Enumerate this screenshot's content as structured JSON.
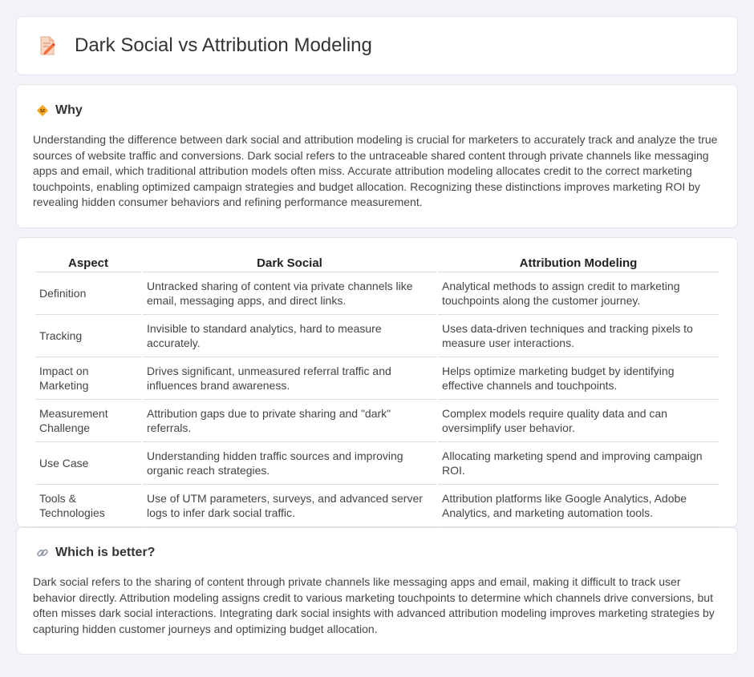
{
  "header": {
    "title": "Dark Social vs Attribution Modeling",
    "icon": "document-edit-icon"
  },
  "why": {
    "title": "Why",
    "icon": "warning-sign-icon",
    "text": "Understanding the difference between dark social and attribution modeling is crucial for marketers to accurately track and analyze the true sources of website traffic and conversions. Dark social refers to the untraceable shared content through private channels like messaging apps and email, which traditional attribution models often miss. Accurate attribution modeling allocates credit to the correct marketing touchpoints, enabling optimized campaign strategies and budget allocation. Recognizing these distinctions improves marketing ROI by revealing hidden consumer behaviors and refining performance measurement."
  },
  "comparison": {
    "headers": [
      "Aspect",
      "Dark Social",
      "Attribution Modeling"
    ],
    "rows": [
      [
        "Definition",
        "Untracked sharing of content via private channels like email, messaging apps, and direct links.",
        "Analytical methods to assign credit to marketing touchpoints along the customer journey."
      ],
      [
        "Tracking",
        "Invisible to standard analytics, hard to measure accurately.",
        "Uses data-driven techniques and tracking pixels to measure user interactions."
      ],
      [
        "Impact on Marketing",
        "Drives significant, unmeasured referral traffic and influences brand awareness.",
        "Helps optimize marketing budget by identifying effective channels and touchpoints."
      ],
      [
        "Measurement Challenge",
        "Attribution gaps due to private sharing and \"dark\" referrals.",
        "Complex models require quality data and can oversimplify user behavior."
      ],
      [
        "Use Case",
        "Understanding hidden traffic sources and improving organic reach strategies.",
        "Allocating marketing spend and improving campaign ROI."
      ],
      [
        "Tools & Technologies",
        "Use of UTM parameters, surveys, and advanced server logs to infer dark social traffic.",
        "Attribution platforms like Google Analytics, Adobe Analytics, and marketing automation tools."
      ]
    ]
  },
  "better": {
    "title": "Which is better?",
    "icon": "link-icon",
    "text": "Dark social refers to the sharing of content through private channels like messaging apps and email, making it difficult to track user behavior directly. Attribution modeling assigns credit to various marketing touchpoints to determine which channels drive conversions, but often misses dark social interactions. Integrating dark social insights with advanced attribution modeling improves marketing strategies by capturing hidden customer journeys and optimizing budget allocation."
  }
}
